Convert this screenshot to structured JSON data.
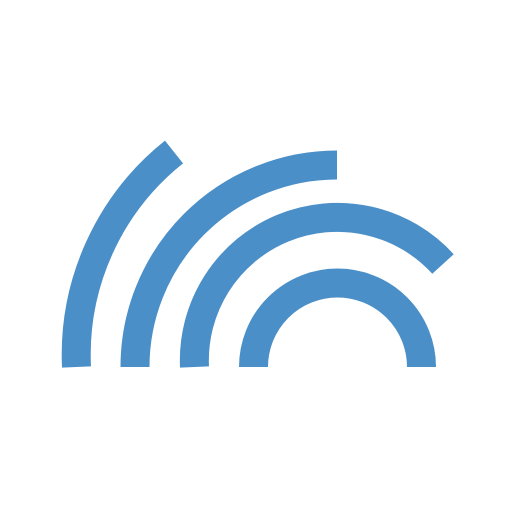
{
  "logo": {
    "icon": "concentric-arcs-signal-icon",
    "color": "#4a8fc8",
    "background": "#ffffff"
  }
}
